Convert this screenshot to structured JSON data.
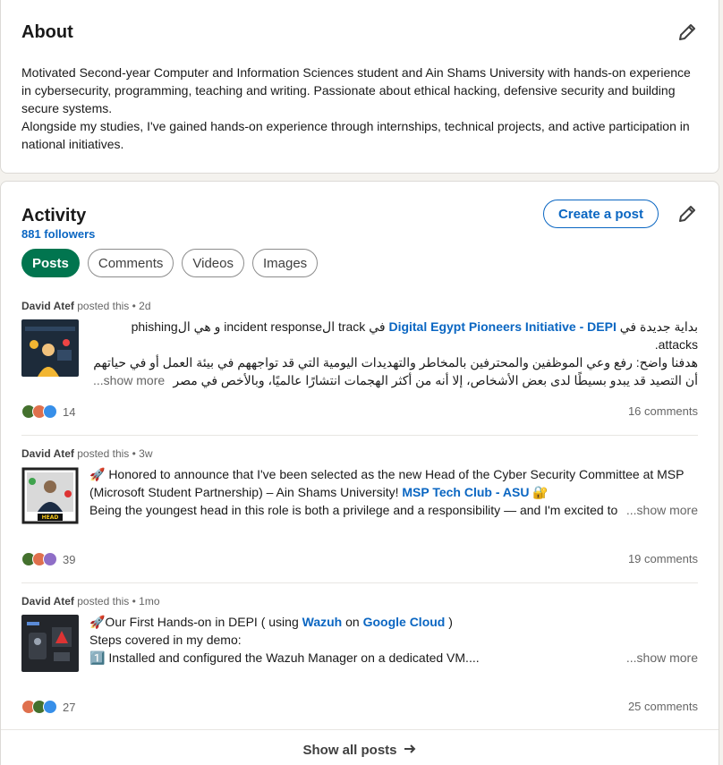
{
  "about": {
    "title": "About",
    "paragraph1": "Motivated Second-year Computer and Information Sciences student and Ain Shams University with hands-on experience in cybersecurity, programming, teaching and writing. Passionate about ethical hacking, defensive security and building secure systems.",
    "paragraph2": "Alongside my studies, I've gained hands-on experience through internships, technical projects, and active participation in national initiatives."
  },
  "activity": {
    "title": "Activity",
    "followers": "881 followers",
    "create_post": "Create a post",
    "tabs": [
      "Posts",
      "Comments",
      "Videos",
      "Images"
    ],
    "show_all": "Show all posts"
  },
  "posts": [
    {
      "author": "David Atef",
      "meta": "posted this • 2d",
      "line1_a": "بداية جديدة في ",
      "line1_link": "Digital Egypt Pioneers Initiative - DEPI",
      "line1_b": " في track الincident response و هي الphishing attacks.",
      "line2": "هدفنا واضح: رفع وعي الموظفين والمحترفين بالمخاطر والتهديدات اليومية التي قد تواجههم في بيئة العمل أو في حياتهم",
      "line3": "أن التصيد قد يبدو بسيطًا لدى بعض الأشخاص، إلا أنه من أكثر الهجمات انتشارًا عالميًا، وبالأخص في مصر",
      "more": "...show more",
      "reactions": "14",
      "comments": "16 comments"
    },
    {
      "author": "David Atef",
      "meta": "posted this • 3w",
      "line1": "🚀 Honored to announce that I've been selected as the new Head of the Cyber Security Committee at MSP",
      "line2_a": "(Microsoft Student Partnership) – Ain Shams University! ",
      "line2_link": "MSP Tech Club - ASU",
      "line2_b": " 🔐",
      "line3": "Being the youngest head in this role is both a privilege and a responsibility — and I'm excited to",
      "more": "...show more",
      "reactions": "39",
      "comments": "19 comments"
    },
    {
      "author": "David Atef",
      "meta": "posted this • 1mo",
      "line1_a": "🚀Our First Hands-on in DEPI ( using ",
      "line1_link1": "Wazuh",
      "line1_b": " on ",
      "line1_link2": "Google Cloud",
      "line1_c": " )",
      "line2": "Steps covered in my demo:",
      "line3": "1️⃣ Installed and configured the Wazuh Manager on a dedicated VM....",
      "more": "...show more",
      "reactions": "27",
      "comments": "25 comments"
    }
  ],
  "colors": {
    "accent": "#0a66c2",
    "active_tab": "#01754f"
  }
}
